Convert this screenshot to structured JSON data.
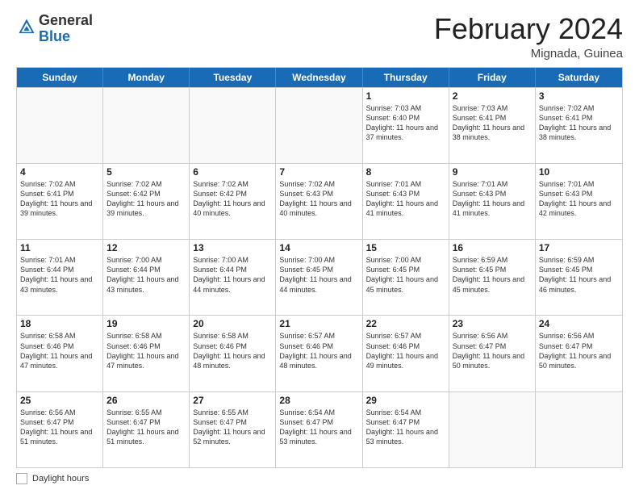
{
  "logo": {
    "general": "General",
    "blue": "Blue"
  },
  "title": "February 2024",
  "subtitle": "Mignada, Guinea",
  "days_of_week": [
    "Sunday",
    "Monday",
    "Tuesday",
    "Wednesday",
    "Thursday",
    "Friday",
    "Saturday"
  ],
  "footer_label": "Daylight hours",
  "weeks": [
    [
      {
        "day": "",
        "empty": true
      },
      {
        "day": "",
        "empty": true
      },
      {
        "day": "",
        "empty": true
      },
      {
        "day": "",
        "empty": true
      },
      {
        "day": "1",
        "sunrise": "7:03 AM",
        "sunset": "6:40 PM",
        "daylight": "11 hours and 37 minutes."
      },
      {
        "day": "2",
        "sunrise": "7:03 AM",
        "sunset": "6:41 PM",
        "daylight": "11 hours and 38 minutes."
      },
      {
        "day": "3",
        "sunrise": "7:02 AM",
        "sunset": "6:41 PM",
        "daylight": "11 hours and 38 minutes."
      }
    ],
    [
      {
        "day": "4",
        "sunrise": "7:02 AM",
        "sunset": "6:41 PM",
        "daylight": "11 hours and 39 minutes."
      },
      {
        "day": "5",
        "sunrise": "7:02 AM",
        "sunset": "6:42 PM",
        "daylight": "11 hours and 39 minutes."
      },
      {
        "day": "6",
        "sunrise": "7:02 AM",
        "sunset": "6:42 PM",
        "daylight": "11 hours and 40 minutes."
      },
      {
        "day": "7",
        "sunrise": "7:02 AM",
        "sunset": "6:43 PM",
        "daylight": "11 hours and 40 minutes."
      },
      {
        "day": "8",
        "sunrise": "7:01 AM",
        "sunset": "6:43 PM",
        "daylight": "11 hours and 41 minutes."
      },
      {
        "day": "9",
        "sunrise": "7:01 AM",
        "sunset": "6:43 PM",
        "daylight": "11 hours and 41 minutes."
      },
      {
        "day": "10",
        "sunrise": "7:01 AM",
        "sunset": "6:43 PM",
        "daylight": "11 hours and 42 minutes."
      }
    ],
    [
      {
        "day": "11",
        "sunrise": "7:01 AM",
        "sunset": "6:44 PM",
        "daylight": "11 hours and 43 minutes."
      },
      {
        "day": "12",
        "sunrise": "7:00 AM",
        "sunset": "6:44 PM",
        "daylight": "11 hours and 43 minutes."
      },
      {
        "day": "13",
        "sunrise": "7:00 AM",
        "sunset": "6:44 PM",
        "daylight": "11 hours and 44 minutes."
      },
      {
        "day": "14",
        "sunrise": "7:00 AM",
        "sunset": "6:45 PM",
        "daylight": "11 hours and 44 minutes."
      },
      {
        "day": "15",
        "sunrise": "7:00 AM",
        "sunset": "6:45 PM",
        "daylight": "11 hours and 45 minutes."
      },
      {
        "day": "16",
        "sunrise": "6:59 AM",
        "sunset": "6:45 PM",
        "daylight": "11 hours and 45 minutes."
      },
      {
        "day": "17",
        "sunrise": "6:59 AM",
        "sunset": "6:45 PM",
        "daylight": "11 hours and 46 minutes."
      }
    ],
    [
      {
        "day": "18",
        "sunrise": "6:58 AM",
        "sunset": "6:46 PM",
        "daylight": "11 hours and 47 minutes."
      },
      {
        "day": "19",
        "sunrise": "6:58 AM",
        "sunset": "6:46 PM",
        "daylight": "11 hours and 47 minutes."
      },
      {
        "day": "20",
        "sunrise": "6:58 AM",
        "sunset": "6:46 PM",
        "daylight": "11 hours and 48 minutes."
      },
      {
        "day": "21",
        "sunrise": "6:57 AM",
        "sunset": "6:46 PM",
        "daylight": "11 hours and 48 minutes."
      },
      {
        "day": "22",
        "sunrise": "6:57 AM",
        "sunset": "6:46 PM",
        "daylight": "11 hours and 49 minutes."
      },
      {
        "day": "23",
        "sunrise": "6:56 AM",
        "sunset": "6:47 PM",
        "daylight": "11 hours and 50 minutes."
      },
      {
        "day": "24",
        "sunrise": "6:56 AM",
        "sunset": "6:47 PM",
        "daylight": "11 hours and 50 minutes."
      }
    ],
    [
      {
        "day": "25",
        "sunrise": "6:56 AM",
        "sunset": "6:47 PM",
        "daylight": "11 hours and 51 minutes."
      },
      {
        "day": "26",
        "sunrise": "6:55 AM",
        "sunset": "6:47 PM",
        "daylight": "11 hours and 51 minutes."
      },
      {
        "day": "27",
        "sunrise": "6:55 AM",
        "sunset": "6:47 PM",
        "daylight": "11 hours and 52 minutes."
      },
      {
        "day": "28",
        "sunrise": "6:54 AM",
        "sunset": "6:47 PM",
        "daylight": "11 hours and 53 minutes."
      },
      {
        "day": "29",
        "sunrise": "6:54 AM",
        "sunset": "6:47 PM",
        "daylight": "11 hours and 53 minutes."
      },
      {
        "day": "",
        "empty": true
      },
      {
        "day": "",
        "empty": true
      }
    ]
  ]
}
